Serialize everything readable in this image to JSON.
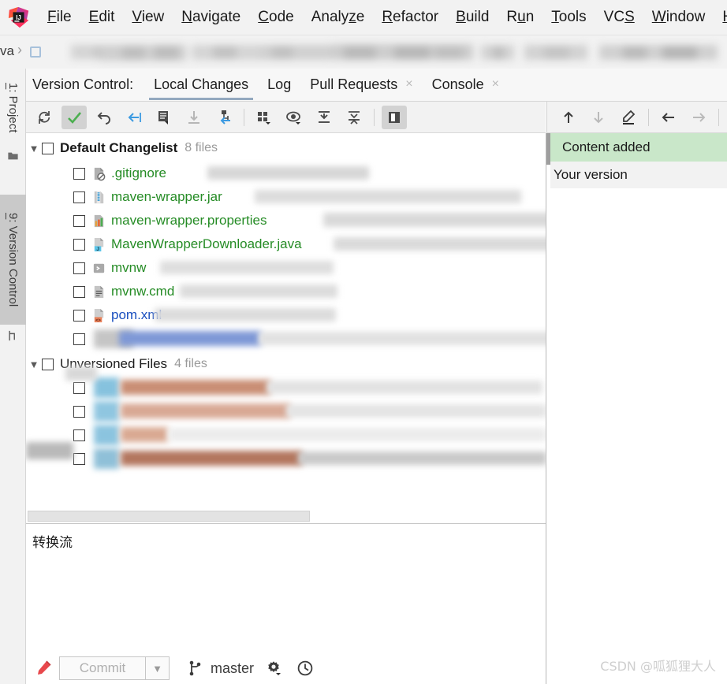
{
  "menu": {
    "logo_icon": "intellij-idea-logo",
    "items": [
      {
        "label": "File",
        "mnemonic": "F"
      },
      {
        "label": "Edit",
        "mnemonic": "E"
      },
      {
        "label": "View",
        "mnemonic": "V"
      },
      {
        "label": "Navigate",
        "mnemonic": "N"
      },
      {
        "label": "Code",
        "mnemonic": "C"
      },
      {
        "label": "Analyze",
        "mnemonic": "z"
      },
      {
        "label": "Refactor",
        "mnemonic": "R"
      },
      {
        "label": "Build",
        "mnemonic": "B"
      },
      {
        "label": "Run",
        "mnemonic": "u"
      },
      {
        "label": "Tools",
        "mnemonic": "T"
      },
      {
        "label": "VCS",
        "mnemonic": "S"
      },
      {
        "label": "Window",
        "mnemonic": "W"
      },
      {
        "label": "Help",
        "mnemonic": "H"
      }
    ]
  },
  "breadcrumb": {
    "visible_fragment": "va",
    "chevron_icon": "chevron-right-icon",
    "note": "remainder of breadcrumb path is blurred/redacted"
  },
  "left_tool_strip": {
    "tabs": [
      {
        "label": "1: Project",
        "number": "1",
        "name": "Project",
        "icon": "folder-icon",
        "active": false
      },
      {
        "label": "9: Version Control",
        "number": "9",
        "name": "Version Control",
        "icon": "branch-icon",
        "active": true
      }
    ]
  },
  "vc_header": {
    "title": "Version Control:",
    "tabs": [
      {
        "label": "Local Changes",
        "active": true,
        "closable": false
      },
      {
        "label": "Log",
        "active": false,
        "closable": false
      },
      {
        "label": "Pull Requests",
        "active": false,
        "closable": true
      },
      {
        "label": "Console",
        "active": false,
        "closable": true
      }
    ],
    "close_glyph": "×"
  },
  "toolbar": {
    "buttons": [
      {
        "name": "refresh-icon",
        "tooltip": "Refresh",
        "selected": false,
        "enabled": true
      },
      {
        "name": "commit-check-icon",
        "tooltip": "Commit",
        "selected": true,
        "enabled": true
      },
      {
        "name": "rollback-icon",
        "tooltip": "Rollback",
        "selected": false,
        "enabled": true
      },
      {
        "name": "shelve-silently-icon",
        "tooltip": "Shelve Silently",
        "selected": false,
        "enabled": true
      },
      {
        "name": "show-diff-icon",
        "tooltip": "Show Diff",
        "selected": false,
        "enabled": true
      },
      {
        "name": "get-from-vcs-icon",
        "tooltip": "Update",
        "selected": false,
        "enabled": false
      },
      {
        "name": "move-to-changelist-icon",
        "tooltip": "Move to Another Changelist",
        "selected": false,
        "enabled": true
      },
      {
        "name": "group-by-icon",
        "tooltip": "Group By",
        "selected": false,
        "enabled": true,
        "has_dropdown": true
      },
      {
        "name": "eye-preview-icon",
        "tooltip": "Preview",
        "selected": false,
        "enabled": true,
        "has_dropdown": true
      },
      {
        "name": "expand-all-icon",
        "tooltip": "Expand All",
        "selected": false,
        "enabled": true
      },
      {
        "name": "collapse-all-icon",
        "tooltip": "Collapse All",
        "selected": false,
        "enabled": true
      },
      {
        "name": "toggle-preview-panel-icon",
        "tooltip": "Preview Diff",
        "selected": true,
        "enabled": true
      }
    ],
    "right_buttons": [
      {
        "name": "previous-difference-icon",
        "tooltip": "Previous Difference",
        "enabled": true
      },
      {
        "name": "next-difference-icon",
        "tooltip": "Next Difference",
        "enabled": false
      },
      {
        "name": "edit-source-icon",
        "tooltip": "Edit Source",
        "enabled": true
      },
      {
        "name": "accept-left-arrow-icon",
        "tooltip": "Accept Left Side",
        "enabled": true
      },
      {
        "name": "accept-right-arrow-icon",
        "tooltip": "Accept Right Side",
        "enabled": false
      }
    ]
  },
  "changes_tree": {
    "groups": [
      {
        "name": "Default Changelist",
        "count_label": "8 files",
        "expanded": true,
        "checked": false,
        "bold": true,
        "files": [
          {
            "name": ".gitignore",
            "status": "added",
            "icon": "gitignore-file-icon",
            "checked": false,
            "path_redacted": true
          },
          {
            "name": "maven-wrapper.jar",
            "status": "added",
            "icon": "jar-archive-icon",
            "checked": false,
            "path_redacted": true
          },
          {
            "name": "maven-wrapper.properties",
            "status": "added",
            "icon": "properties-file-icon",
            "checked": false,
            "path_redacted": true
          },
          {
            "name": "MavenWrapperDownloader.java",
            "status": "added",
            "icon": "java-file-icon",
            "checked": false,
            "path_redacted": true
          },
          {
            "name": "mvnw",
            "status": "added",
            "icon": "shell-script-icon",
            "checked": false,
            "path_redacted": true
          },
          {
            "name": "mvnw.cmd",
            "status": "added",
            "icon": "text-file-icon",
            "checked": false,
            "path_redacted": true
          },
          {
            "name": "pom.xml",
            "status": "modified",
            "icon": "xml-file-icon",
            "checked": false,
            "path_redacted": true
          },
          {
            "name": "",
            "status": "redacted",
            "icon": "file-icon",
            "checked": false,
            "path_redacted": true
          }
        ]
      },
      {
        "name": "Unversioned Files",
        "count_label": "4 files",
        "expanded": true,
        "checked": false,
        "bold": false,
        "files": [
          {
            "name": "",
            "status": "redacted",
            "icon": "java-file-icon",
            "checked": false,
            "path_redacted": true
          },
          {
            "name": "",
            "status": "redacted",
            "icon": "java-file-icon",
            "checked": false,
            "path_redacted": true
          },
          {
            "name": "",
            "status": "redacted",
            "icon": "java-file-icon",
            "checked": false,
            "path_redacted": true
          },
          {
            "name": "",
            "status": "redacted",
            "icon": "java-file-icon",
            "checked": false,
            "path_redacted": true
          }
        ]
      }
    ]
  },
  "commit_message": {
    "value": "转换流",
    "placeholder": ""
  },
  "diff_panel": {
    "added_label": "Content added",
    "your_version_label": "Your version"
  },
  "bottom_bar": {
    "edit_icon": "pencil-edit-icon",
    "commit_label": "Commit",
    "commit_enabled": false,
    "commit_dropdown_icon": "chevron-down-icon",
    "branch_icon": "git-branch-icon",
    "branch_name": "master",
    "settings_icon": "gear-icon",
    "history_icon": "clock-history-icon"
  },
  "watermark": {
    "text": "CSDN @呱狐狸大人"
  },
  "colors": {
    "added_green": "#268c26",
    "modified_blue": "#1a4fbf",
    "diff_added_bg": "#c9e7c9",
    "tab_underline": "#93a8bf",
    "toolbar_bg": "#f2f2f2",
    "accent_blue": "#3b9ae1"
  }
}
